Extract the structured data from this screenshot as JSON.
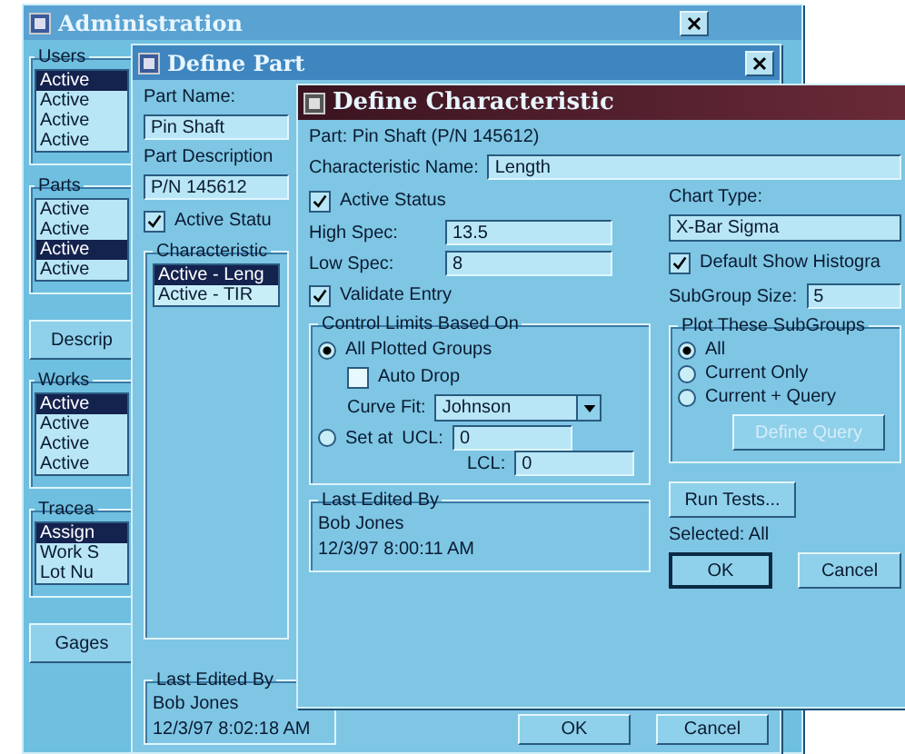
{
  "admin": {
    "title": "Administration",
    "sections": [
      {
        "kind": "group",
        "label": "Users",
        "items": [
          {
            "text": "Active",
            "selected": true
          },
          {
            "text": "Active",
            "selected": false
          },
          {
            "text": "Active",
            "selected": false
          },
          {
            "text": "Active",
            "selected": false
          }
        ]
      },
      {
        "kind": "group",
        "label": "Parts",
        "items": [
          {
            "text": "Active",
            "selected": false
          },
          {
            "text": "Active",
            "selected": false
          },
          {
            "text": "Active",
            "selected": true
          },
          {
            "text": "Active",
            "selected": false
          }
        ]
      },
      {
        "kind": "button",
        "label": "Descrip"
      },
      {
        "kind": "group",
        "label": "Works",
        "items": [
          {
            "text": "Active",
            "selected": true
          },
          {
            "text": "Active",
            "selected": false
          },
          {
            "text": "Active",
            "selected": false
          },
          {
            "text": "Active",
            "selected": false
          }
        ]
      },
      {
        "kind": "group",
        "label": "Tracea",
        "items": [
          {
            "text": "Assign",
            "selected": true
          },
          {
            "text": "Work S",
            "selected": false
          },
          {
            "text": "Lot Nu",
            "selected": false
          }
        ]
      },
      {
        "kind": "button",
        "label": "Gages"
      }
    ]
  },
  "define_part": {
    "title": "Define Part",
    "part_name": {
      "label": "Part Name:",
      "value": "Pin Shaft"
    },
    "part_description": {
      "label": "Part Description",
      "value": "P/N 145612"
    },
    "active_status": {
      "label": "Active Statu",
      "checked": true
    },
    "characteristics": {
      "label": "Characteristic",
      "items": [
        {
          "text": "Active - Leng",
          "selected": true
        },
        {
          "text": "Active - TIR",
          "selected": false
        }
      ]
    },
    "last_edited": {
      "label": "Last Edited By",
      "name": "Bob Jones",
      "date": "12/3/97 8:02:18 AM"
    },
    "buttons": [
      "OK",
      "Cancel"
    ]
  },
  "define_characteristic": {
    "title": "Define Characteristic",
    "part": "Part: Pin Shaft (P/N 145612)",
    "name": {
      "label": "Characteristic Name:",
      "value": "Length"
    },
    "active_status": {
      "label": "Active Status",
      "checked": true
    },
    "high_spec": {
      "label": "High Spec:",
      "value": "13.5"
    },
    "low_spec": {
      "label": "Low Spec:",
      "value": "8"
    },
    "validate_entry": {
      "label": "Validate Entry",
      "checked": true
    },
    "control_limits": {
      "label": "Control Limits Based On",
      "all_plotted": {
        "label": "All Plotted Groups",
        "selected": true
      },
      "auto_drop": {
        "label": "Auto Drop",
        "checked": false
      },
      "curve_fit": {
        "label": "Curve Fit:",
        "value": "Johnson"
      },
      "set_at": {
        "label": "Set at",
        "selected": false
      },
      "ucl": {
        "label": "UCL:",
        "value": "0"
      },
      "lcl": {
        "label": "LCL:",
        "value": "0"
      }
    },
    "last_edited": {
      "label": "Last Edited By",
      "name": "Bob Jones",
      "date": "12/3/97 8:00:11 AM"
    },
    "chart_type": {
      "label": "Chart Type:",
      "value": "X-Bar Sigma"
    },
    "default_show_histogram": {
      "label": "Default Show Histogra",
      "checked": true
    },
    "subgroup_size": {
      "label": "SubGroup Size:",
      "value": "5"
    },
    "plot_subgroups": {
      "label": "Plot These SubGroups",
      "options": [
        {
          "label": "All",
          "selected": true
        },
        {
          "label": "Current Only",
          "selected": false
        },
        {
          "label": "Current + Query",
          "selected": false
        }
      ],
      "define_query": {
        "label": "Define Query",
        "disabled": true
      }
    },
    "run_tests": "Run Tests...",
    "selected_text": "Selected: All",
    "buttons": [
      "OK",
      "Cancel"
    ]
  }
}
